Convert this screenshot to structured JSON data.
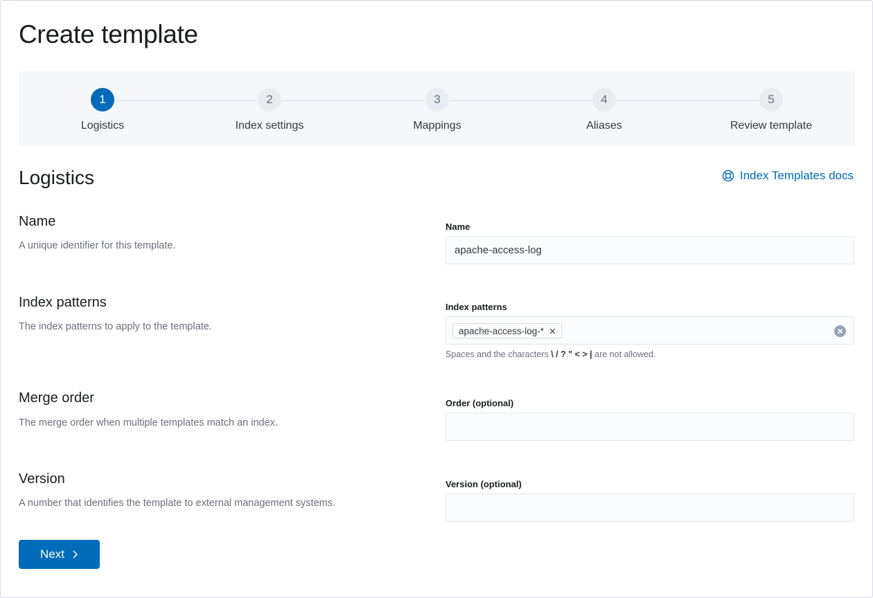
{
  "page": {
    "title": "Create template"
  },
  "steps": [
    {
      "number": "1",
      "label": "Logistics",
      "current": true
    },
    {
      "number": "2",
      "label": "Index settings",
      "current": false
    },
    {
      "number": "3",
      "label": "Mappings",
      "current": false
    },
    {
      "number": "4",
      "label": "Aliases",
      "current": false
    },
    {
      "number": "5",
      "label": "Review template",
      "current": false
    }
  ],
  "section": {
    "title": "Logistics",
    "docs_link": "Index Templates docs",
    "docs_icon": "help-lifebuoy-icon"
  },
  "fields": {
    "name": {
      "title": "Name",
      "description": "A unique identifier for this template.",
      "label": "Name",
      "value": "apache-access-log"
    },
    "index_patterns": {
      "title": "Index patterns",
      "description": "The index patterns to apply to the template.",
      "label": "Index patterns",
      "pills": [
        "apache-access-log-*"
      ],
      "help_prefix": "Spaces and the characters",
      "help_chars": "\\ / ? \" < > |",
      "help_suffix": "are not allowed."
    },
    "order": {
      "title": "Merge order",
      "description": "The merge order when multiple templates match an index.",
      "label": "Order (optional)",
      "value": ""
    },
    "version": {
      "title": "Version",
      "description": "A number that identifies the template to external management systems.",
      "label": "Version (optional)",
      "value": ""
    }
  },
  "actions": {
    "next_label": "Next"
  },
  "colors": {
    "primary": "#006bb8",
    "text_subdued": "#69707d",
    "step_bg": "#f5f7fa"
  }
}
